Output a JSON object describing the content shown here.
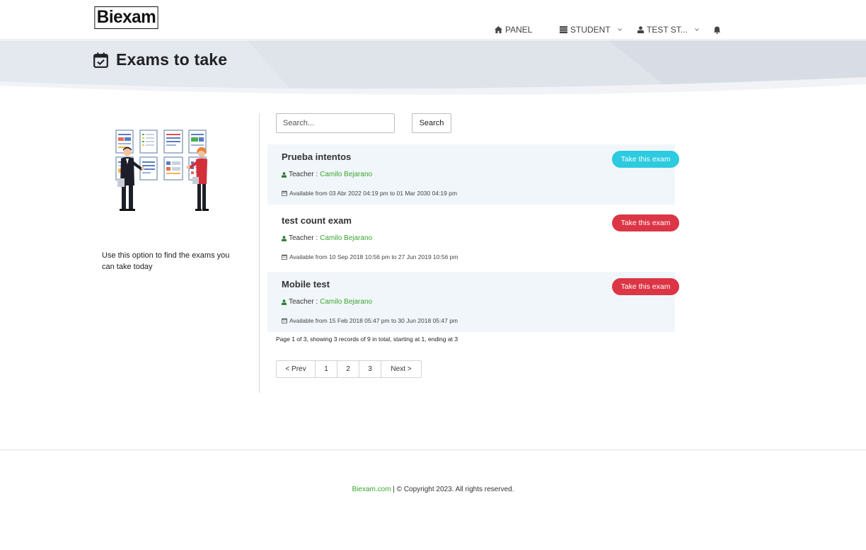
{
  "brand": {
    "logo_text": "Biexam"
  },
  "nav": {
    "panel": "PANEL",
    "student": "STUDENT",
    "user": "TEST ST..."
  },
  "page": {
    "title": "Exams to take"
  },
  "sidebar": {
    "description": "Use this option to find the exams you can take today"
  },
  "search": {
    "placeholder": "Search...",
    "button": "Search"
  },
  "exams": [
    {
      "title": "Prueba intentos",
      "teacher_label": "Teacher :",
      "teacher": "Camilo Bejarano",
      "available": "Available from 03 Abr 2022 04:19 pm to 01 Mar 2030 04:19 pm",
      "action": "Take this exam",
      "action_color": "#2ccbe0"
    },
    {
      "title": "test count exam",
      "teacher_label": "Teacher :",
      "teacher": "Camilo Bejarano",
      "available": "Available from 10 Sep 2018 10:56 pm to 27 Jun 2019 10:56 pm",
      "action": "Take this exam",
      "action_color": "#dc3545"
    },
    {
      "title": "Mobile test",
      "teacher_label": "Teacher :",
      "teacher": "Camilo Bejarano",
      "available": "Available from 15 Feb 2018 05:47 pm to 30 Jun 2018 05:47 pm",
      "action": "Take this exam",
      "action_color": "#dc3545"
    }
  ],
  "pagination": {
    "info": "Page 1 of 3, showing 3 records of 9 in total, starting at 1, ending at 3",
    "prev": "< Prev",
    "pages": [
      "1",
      "2",
      "3"
    ],
    "next": "Next >"
  },
  "footer": {
    "link": "Biexam.com",
    "text": " | © Copyright  2023.  All rights reserved."
  },
  "colors": {
    "accent_green": "#3aa62f",
    "banner_bg": "#e4e8ef"
  }
}
